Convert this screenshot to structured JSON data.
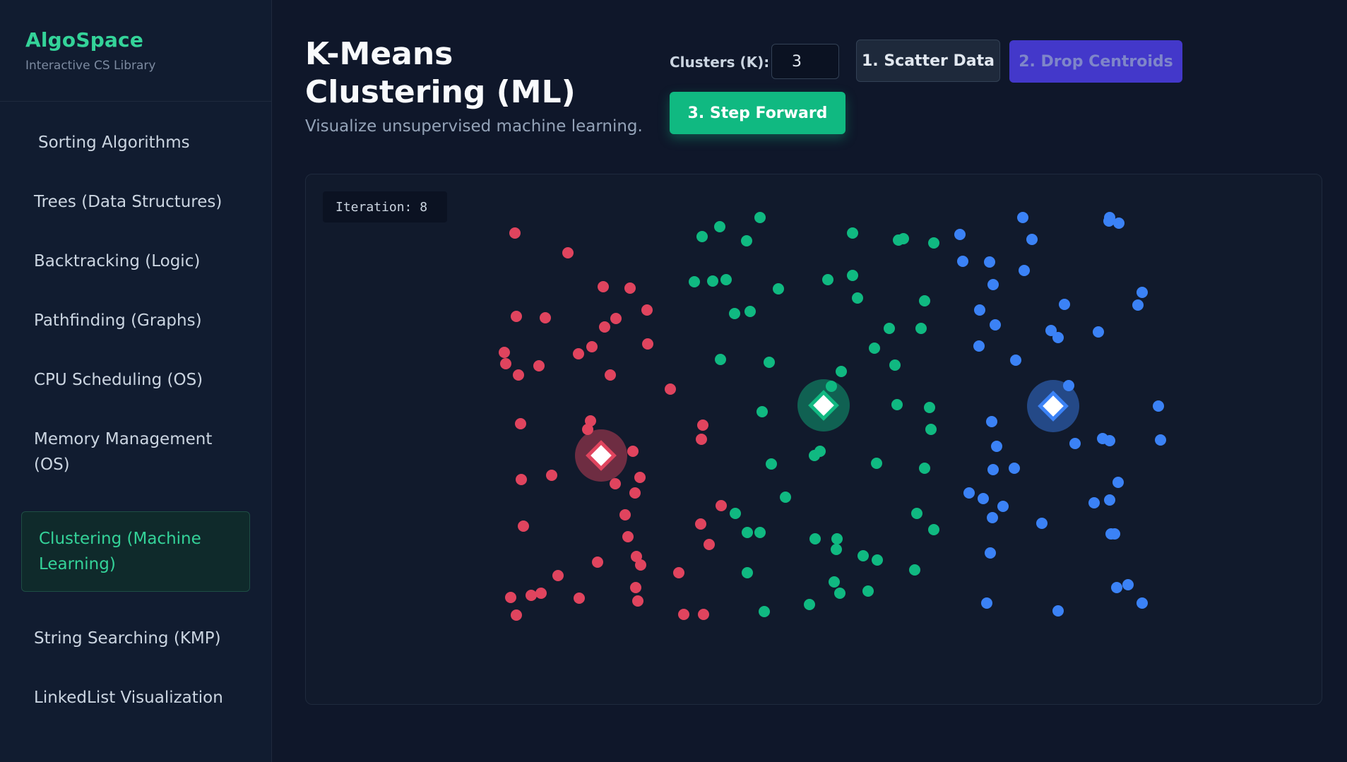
{
  "sidebar": {
    "brand": "AlgoSpace",
    "subtitle": "Interactive CS Library",
    "items": [
      {
        "label": "Sorting Algorithms"
      },
      {
        "label": "Trees (Data Structures)"
      },
      {
        "label": "Backtracking (Logic)"
      },
      {
        "label": "Pathfinding (Graphs)"
      },
      {
        "label": "CPU Scheduling (OS)"
      },
      {
        "label": "Memory Management (OS)"
      },
      {
        "label": "Clustering (Machine Learning)",
        "active": true
      },
      {
        "label": "String Searching (KMP)"
      },
      {
        "label": "LinkedList Visualization"
      }
    ]
  },
  "header": {
    "title": "K-Means Clustering (ML)",
    "subtitle": "Visualize unsupervised machine learning."
  },
  "controls": {
    "k_label": "Clusters (K):",
    "k_value": "3",
    "scatter_label": "1. Scatter Data",
    "drop_label": "2. Drop Centroids",
    "step_label": "3. Step Forward"
  },
  "canvas": {
    "iteration_label": "Iteration: ",
    "iteration_value": "8",
    "colors": {
      "red": "#e0445e",
      "green": "#10b981",
      "blue": "#3b82f6"
    },
    "clusters": [
      {
        "color": "red",
        "centroid": [
          265,
          364
        ],
        "points": [
          [
            143,
            49
          ],
          [
            218,
            77
          ],
          [
            268,
            125
          ],
          [
            306,
            127
          ],
          [
            145,
            167
          ],
          [
            186,
            169
          ],
          [
            286,
            170
          ],
          [
            270,
            182
          ],
          [
            330,
            158
          ],
          [
            252,
            210
          ],
          [
            331,
            206
          ],
          [
            128,
            218
          ],
          [
            233,
            220
          ],
          [
            130,
            234
          ],
          [
            177,
            237
          ],
          [
            148,
            250
          ],
          [
            278,
            250
          ],
          [
            363,
            270
          ],
          [
            151,
            319
          ],
          [
            250,
            315
          ],
          [
            246,
            327
          ],
          [
            409,
            321
          ],
          [
            407,
            341
          ],
          [
            310,
            358
          ],
          [
            152,
            398
          ],
          [
            195,
            392
          ],
          [
            285,
            404
          ],
          [
            320,
            395
          ],
          [
            313,
            417
          ],
          [
            435,
            435
          ],
          [
            299,
            448
          ],
          [
            406,
            461
          ],
          [
            155,
            464
          ],
          [
            303,
            479
          ],
          [
            418,
            490
          ],
          [
            315,
            507
          ],
          [
            260,
            515
          ],
          [
            321,
            519
          ],
          [
            204,
            534
          ],
          [
            375,
            530
          ],
          [
            314,
            551
          ],
          [
            137,
            565
          ],
          [
            166,
            562
          ],
          [
            180,
            559
          ],
          [
            234,
            566
          ],
          [
            317,
            570
          ],
          [
            145,
            590
          ],
          [
            382,
            589
          ],
          [
            410,
            589
          ]
        ]
      },
      {
        "color": "green",
        "centroid": [
          580,
          293
        ],
        "points": [
          [
            490,
            27
          ],
          [
            433,
            40
          ],
          [
            408,
            54
          ],
          [
            471,
            60
          ],
          [
            621,
            49
          ],
          [
            686,
            59
          ],
          [
            693,
            57
          ],
          [
            736,
            63
          ],
          [
            397,
            118
          ],
          [
            423,
            117
          ],
          [
            442,
            115
          ],
          [
            516,
            128
          ],
          [
            586,
            115
          ],
          [
            621,
            109
          ],
          [
            628,
            141
          ],
          [
            454,
            163
          ],
          [
            476,
            160
          ],
          [
            723,
            145
          ],
          [
            673,
            184
          ],
          [
            718,
            184
          ],
          [
            652,
            212
          ],
          [
            681,
            236
          ],
          [
            434,
            228
          ],
          [
            503,
            232
          ],
          [
            605,
            245
          ],
          [
            591,
            266
          ],
          [
            684,
            292
          ],
          [
            730,
            296
          ],
          [
            493,
            302
          ],
          [
            732,
            327
          ],
          [
            567,
            364
          ],
          [
            575,
            358
          ],
          [
            506,
            376
          ],
          [
            655,
            375
          ],
          [
            723,
            382
          ],
          [
            526,
            423
          ],
          [
            455,
            446
          ],
          [
            712,
            446
          ],
          [
            472,
            473
          ],
          [
            490,
            473
          ],
          [
            568,
            482
          ],
          [
            599,
            482
          ],
          [
            598,
            497
          ],
          [
            636,
            506
          ],
          [
            656,
            512
          ],
          [
            736,
            469
          ],
          [
            709,
            526
          ],
          [
            472,
            530
          ],
          [
            595,
            543
          ],
          [
            603,
            559
          ],
          [
            643,
            556
          ],
          [
            560,
            575
          ],
          [
            496,
            585
          ]
        ]
      },
      {
        "color": "blue",
        "centroid": [
          905,
          294
        ],
        "points": [
          [
            862,
            27
          ],
          [
            985,
            27
          ],
          [
            984,
            32
          ],
          [
            998,
            35
          ],
          [
            773,
            51
          ],
          [
            875,
            58
          ],
          [
            777,
            89
          ],
          [
            815,
            90
          ],
          [
            864,
            102
          ],
          [
            820,
            122
          ],
          [
            1031,
            133
          ],
          [
            1025,
            151
          ],
          [
            801,
            158
          ],
          [
            921,
            150
          ],
          [
            823,
            179
          ],
          [
            902,
            187
          ],
          [
            912,
            197
          ],
          [
            969,
            189
          ],
          [
            800,
            209
          ],
          [
            852,
            229
          ],
          [
            927,
            265
          ],
          [
            1054,
            294
          ],
          [
            818,
            316
          ],
          [
            975,
            340
          ],
          [
            985,
            343
          ],
          [
            1057,
            342
          ],
          [
            825,
            351
          ],
          [
            936,
            347
          ],
          [
            820,
            384
          ],
          [
            850,
            382
          ],
          [
            997,
            402
          ],
          [
            786,
            417
          ],
          [
            806,
            425
          ],
          [
            834,
            436
          ],
          [
            963,
            431
          ],
          [
            985,
            427
          ],
          [
            819,
            452
          ],
          [
            889,
            460
          ],
          [
            987,
            475
          ],
          [
            992,
            475
          ],
          [
            816,
            502
          ],
          [
            995,
            551
          ],
          [
            1011,
            547
          ],
          [
            811,
            573
          ],
          [
            912,
            584
          ],
          [
            1031,
            573
          ]
        ]
      }
    ]
  }
}
